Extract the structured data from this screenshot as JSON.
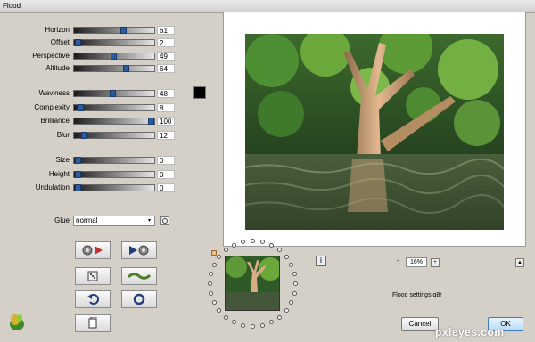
{
  "window": {
    "title": "Flood"
  },
  "params": [
    {
      "label": "Horizon",
      "value": "61",
      "level": 0.61
    },
    {
      "label": "Offset",
      "value": "2",
      "level": 0.02
    },
    {
      "label": "Perspective",
      "value": "49",
      "level": 0.49
    },
    {
      "label": "Altitude",
      "value": "64",
      "level": 0.64
    },
    {
      "label": "Waviness",
      "value": "48",
      "level": 0.48
    },
    {
      "label": "Complexity",
      "value": "8",
      "level": 0.08
    },
    {
      "label": "Brilliance",
      "value": "100",
      "level": 1.0
    },
    {
      "label": "Blur",
      "value": "12",
      "level": 0.12
    },
    {
      "label": "Size",
      "value": "0",
      "level": 0
    },
    {
      "label": "Height",
      "value": "0",
      "level": 0
    },
    {
      "label": "Undulation",
      "value": "0",
      "level": 0
    }
  ],
  "colors": {
    "swatch": "#000000",
    "slider_thumb": "#2b5d9e"
  },
  "glue": {
    "label": "Glue",
    "selected": "normal",
    "arrow": "▾"
  },
  "icons": {
    "glue_opt": "settings-icon",
    "random_prev": "random-previous-icon",
    "random_next": "random-next-icon",
    "dice": "dice-icon",
    "wave": "wave-preset-icon",
    "undo": "undo-icon",
    "reset": "reset-icon",
    "copy": "copy-icon",
    "logo": "filter-logo-icon",
    "info": "info-icon"
  },
  "zoom": {
    "minus": "-",
    "value": "16%",
    "plus": "+"
  },
  "info_glyph": "i",
  "collapse_glyph": "▲",
  "settings_file": "Flood settings.q8r",
  "buttons": {
    "cancel": "Cancel",
    "ok": "OK"
  },
  "watermark": "pxleyes.com"
}
